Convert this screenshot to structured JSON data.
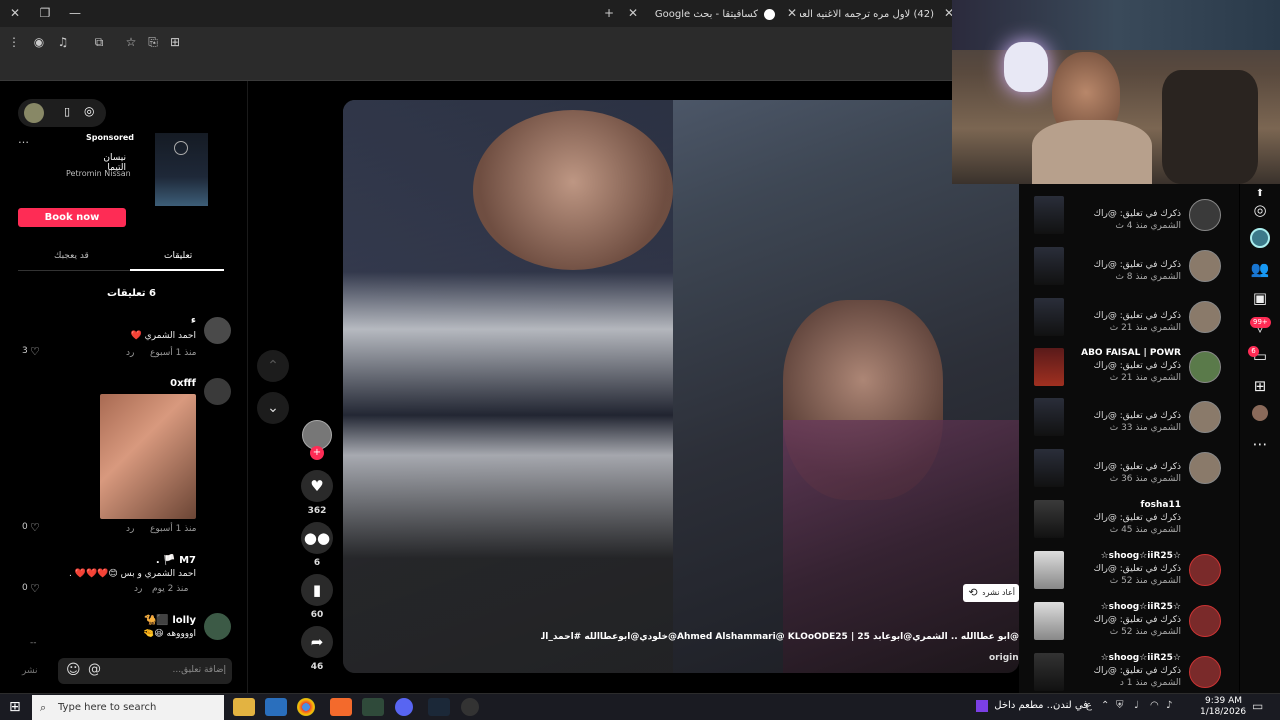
{
  "browser": {
    "tabs": [
      {
        "label": "(42) لاول مره ترجمه الاغنيه العسـ"
      },
      {
        "label": "كسافيتقا - بحث Google"
      }
    ]
  },
  "sidebar": {
    "sponsored": {
      "label": "Sponsored",
      "title": "نيسان التيما",
      "brand": "Petromin Nissan",
      "cta": "Book now"
    },
    "tabs": [
      {
        "label": "قد يعجبك"
      },
      {
        "label": "تعليقات"
      }
    ],
    "comments_count": "6 تعليقات",
    "comments": [
      {
        "name": "ء",
        "text": "احمد الشمري ❤️",
        "time": "منذ 1 أسبوع",
        "reply": "رد",
        "likes": "3"
      },
      {
        "name": "0xfff",
        "text": "",
        "time": "منذ 1 أسبوع",
        "reply": "رد",
        "likes": "0"
      },
      {
        "name": "M7 🏳️ .",
        "text": "احمد الشمري و بس 😊❤️❤️❤️ .",
        "time": "منذ 2 يوم",
        "reply": "رد",
        "likes": "0"
      },
      {
        "name": "lolly ⬛🐪",
        "text": "اووووهه 😆🤏",
        "time": "",
        "reply": "",
        "likes": ""
      }
    ],
    "input_placeholder": "إضافة تعليق...",
    "post_label": "نشر"
  },
  "actions": {
    "likes": "362",
    "comments": "6",
    "saves": "60",
    "shares": "46"
  },
  "video": {
    "caption": "@ابو عطاالله .. الشمري@ابوعابد Ahmed Alshammari@ KLOoODE25 | 25@خلودي@ابوعطاالله #احمد_الشمري #الشمري_",
    "original_label": "original",
    "repost_label": "أعاد نشره"
  },
  "notifications": [
    {
      "title": "",
      "text": "ذكرك في تعليق: @راك",
      "sub": "الشمري منذ 4 ث"
    },
    {
      "title": "",
      "text": "ذكرك في تعليق: @راك",
      "sub": "الشمري منذ 8 ث"
    },
    {
      "title": "",
      "text": "ذكرك في تعليق: @راك",
      "sub": "الشمري منذ 21 ث"
    },
    {
      "title": "ABO FAISAL | POWR",
      "text": "ذكرك في تعليق: @راك",
      "sub": "الشمري منذ 21 ث"
    },
    {
      "title": "",
      "text": "ذكرك في تعليق: @راك",
      "sub": "الشمري منذ 33 ث"
    },
    {
      "title": "",
      "text": "ذكرك في تعليق: @راك",
      "sub": "الشمري منذ 36 ث"
    },
    {
      "title": "fosha11",
      "text": "ذكرك في تعليق: @راك",
      "sub": "الشمري منذ 45 ث"
    },
    {
      "title": "☆shoog☆iiR25☆",
      "text": "ذكرك في تعليق: @راك",
      "sub": "الشمري منذ 52 ث"
    },
    {
      "title": "☆shoog☆iiR25☆",
      "text": "ذكرك في تعليق: @راك",
      "sub": "الشمري منذ 52 ث"
    },
    {
      "title": "☆shoog☆iiR25☆",
      "text": "ذكرك في تعليق: @راك",
      "sub": "الشمري منذ 1 د"
    }
  ],
  "rail": {
    "inbox_badge": "99+",
    "messages_badge": "6"
  },
  "taskbar": {
    "search_placeholder": "Type here to search",
    "media_text": "في لندن.. مطعم داخل...",
    "lang": "ع",
    "time": "9:39 AM",
    "date": "1/18/2026"
  }
}
